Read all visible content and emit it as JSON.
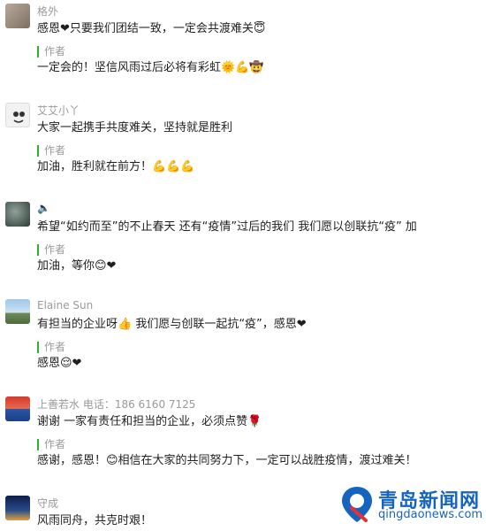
{
  "comments": [
    {
      "name": "格外",
      "text": "感恩❤只要我们团结一致，一定会共渡难关😇",
      "reply_label": "作者",
      "reply": "一定会的！坚信风雨过后必将有彩虹🌞💪🤠"
    },
    {
      "name": "艾艾小丫",
      "text": "大家一起携手共度难关，坚持就是胜利",
      "reply_label": "作者",
      "reply": "加油，胜利就在前方！💪💪💪"
    },
    {
      "name": "🔈",
      "text": "希望“如约而至”的不止春天 还有“疫情”过后的我们 我们愿以创联抗“疫” 加",
      "reply_label": "作者",
      "reply": "加油，等你😊❤"
    },
    {
      "name": "Elaine Sun",
      "text": "有担当的企业呀👍 我们愿与创联一起抗“疫”，感恩❤",
      "reply_label": "作者",
      "reply": "感恩😌❤"
    },
    {
      "name": "上善若水 电话：186 6160 7125",
      "text": "谢谢 一家有责任和担当的企业，必须点赞🌹",
      "reply_label": "作者",
      "reply": "感谢，感恩！😊相信在大家的共同努力下，一定可以战胜疫情，渡过难关！"
    },
    {
      "name": "守成",
      "text": "风雨同舟，共克时艰！"
    }
  ],
  "watermark": {
    "title": "青岛新闻网",
    "url": "qingdaonews.com",
    "color": "#1565c0"
  },
  "colors": {
    "name": "#9a9a9a",
    "reply_bar": "#2ab42a",
    "heart": "#e8322e"
  }
}
